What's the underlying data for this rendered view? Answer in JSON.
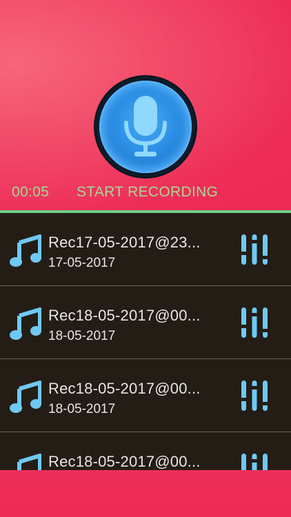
{
  "recorder": {
    "timer": "00:05",
    "action_label": "START RECORDING"
  },
  "recordings": [
    {
      "title": "Rec17-05-2017@23...",
      "date": "17-05-2017"
    },
    {
      "title": "Rec18-05-2017@00...",
      "date": "18-05-2017"
    },
    {
      "title": "Rec18-05-2017@00...",
      "date": "18-05-2017"
    },
    {
      "title": "Rec18-05-2017@00...",
      "date": ""
    }
  ],
  "colors": {
    "header_bg": "#ee2e58",
    "accent_green": "#a6d994",
    "divider": "#6fcf85",
    "icon_blue": "#6fc9f2",
    "list_bg": "#241d16"
  },
  "icons": {
    "mic": "microphone-icon",
    "note": "music-note-icon",
    "equalizer": "equalizer-icon"
  }
}
